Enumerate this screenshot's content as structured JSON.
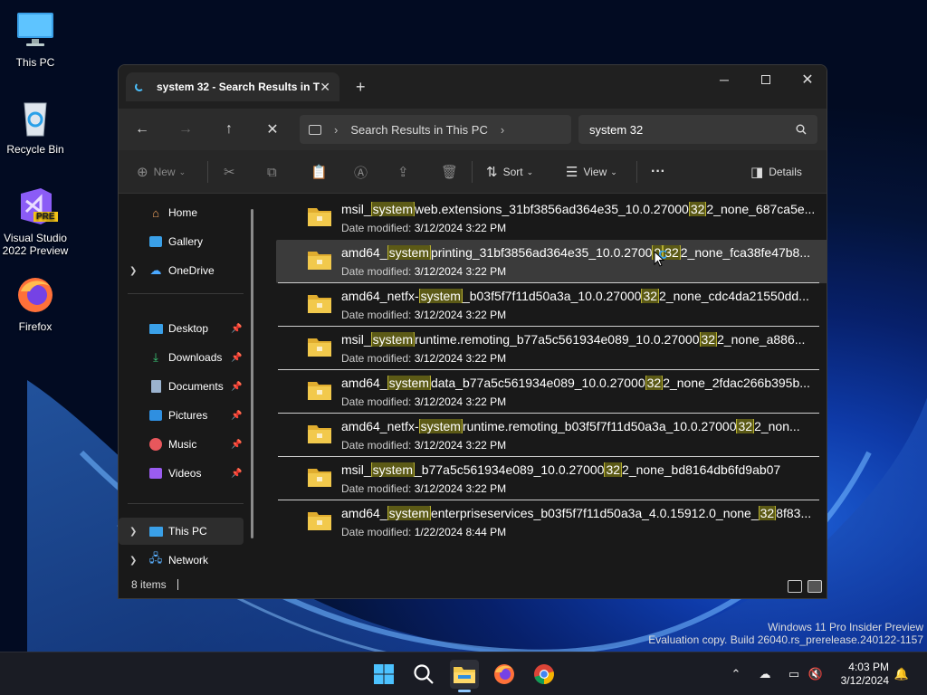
{
  "desktop": {
    "icons": [
      {
        "label": "This PC",
        "icon": "monitor-icon"
      },
      {
        "label": "Recycle Bin",
        "icon": "recycle-bin-icon"
      },
      {
        "label": "Visual Studio 2022 Preview",
        "icon": "visual-studio-icon",
        "badge": "PRE"
      },
      {
        "label": "Firefox",
        "icon": "firefox-icon"
      }
    ]
  },
  "explorer": {
    "tab_title": "system 32 - Search Results in T",
    "new_tab_symbol": "+",
    "address": {
      "segment": "Search Results in This PC"
    },
    "search": {
      "value": "system 32"
    },
    "command_bar": {
      "new_label": "New",
      "sort_label": "Sort",
      "view_label": "View",
      "more_label": "···",
      "details_label": "Details"
    },
    "nav": {
      "items": [
        {
          "label": "Home",
          "icon": "home-icon"
        },
        {
          "label": "Gallery",
          "icon": "gallery-icon"
        },
        {
          "label": "OneDrive",
          "icon": "onedrive-icon",
          "expandable": true
        },
        {
          "label": "Desktop",
          "icon": "desktop-icon",
          "pinned": true
        },
        {
          "label": "Downloads",
          "icon": "downloads-icon",
          "pinned": true
        },
        {
          "label": "Documents",
          "icon": "documents-icon",
          "pinned": true
        },
        {
          "label": "Pictures",
          "icon": "pictures-icon",
          "pinned": true
        },
        {
          "label": "Music",
          "icon": "music-icon",
          "pinned": true
        },
        {
          "label": "Videos",
          "icon": "videos-icon",
          "pinned": true
        },
        {
          "label": "This PC",
          "icon": "this-pc-icon",
          "expandable": true,
          "selected": true
        },
        {
          "label": "Network",
          "icon": "network-icon",
          "expandable": true
        }
      ]
    },
    "results": [
      {
        "parts": [
          "msil_",
          "system",
          "web.extensions_31bf3856ad364e35_10.0.27000",
          "32",
          "2_none_687ca5e..."
        ],
        "date_label": "Date modified:",
        "date": "3/12/2024 3:22 PM"
      },
      {
        "parts": [
          "amd64_",
          "system",
          "printing_31bf3856ad364e35_10.0.2700",
          "0",
          "32",
          "2_none_fca38fe47b8..."
        ],
        "date_label": "Date modified:",
        "date": "3/12/2024 3:22 PM"
      },
      {
        "parts": [
          "amd64_netfx-",
          "system",
          "_b03f5f7f11d50a3a_10.0.27000",
          "32",
          "2_none_cdc4da21550dd..."
        ],
        "date_label": "Date modified:",
        "date": "3/12/2024 3:22 PM"
      },
      {
        "parts": [
          "msil_",
          "system",
          "runtime.remoting_b77a5c561934e089_10.0.27000",
          "32",
          "2_none_a886..."
        ],
        "date_label": "Date modified:",
        "date": "3/12/2024 3:22 PM"
      },
      {
        "parts": [
          "amd64_",
          "system",
          "data_b77a5c561934e089_10.0.27000",
          "32",
          "2_none_2fdac266b395b..."
        ],
        "date_label": "Date modified:",
        "date": "3/12/2024 3:22 PM"
      },
      {
        "parts": [
          "amd64_netfx-",
          "system",
          "runtime.remoting_b03f5f7f11d50a3a_10.0.27000",
          "32",
          "2_non..."
        ],
        "date_label": "Date modified:",
        "date": "3/12/2024 3:22 PM"
      },
      {
        "parts": [
          "msil_",
          "system",
          "_b77a5c561934e089_10.0.27000",
          "32",
          "2_none_bd8164db6fd9ab07"
        ],
        "date_label": "Date modified:",
        "date": "3/12/2024 3:22 PM"
      },
      {
        "parts": [
          "amd64_",
          "system",
          "enterpriseservices_b03f5f7f11d50a3a_4.0.15912.0_none_",
          "32",
          "8f83..."
        ],
        "date_label": "Date modified:",
        "date": "1/22/2024 8:44 PM"
      }
    ],
    "status": {
      "item_count": "8 items"
    }
  },
  "watermark": {
    "line1": "Windows 11 Pro Insider Preview",
    "line2": "Evaluation copy. Build 26040.rs_prerelease.240122-1157"
  },
  "taskbar": {
    "clock_time": "4:03 PM",
    "clock_date": "3/12/2024"
  },
  "colors": {
    "highlight_bg": "#5c5a16",
    "highlight_border": "#b7b032",
    "accent": "#4cc2ff",
    "folder": "#f2c94c"
  }
}
